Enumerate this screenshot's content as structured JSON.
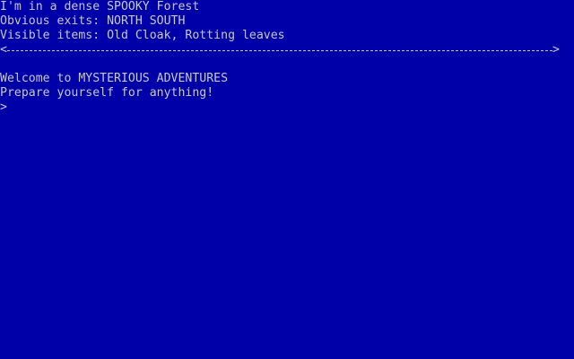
{
  "room": {
    "description": "I'm in a dense SPOOKY Forest",
    "exits": "Obvious exits: NORTH SOUTH",
    "items": "Visible items: Old Cloak, Rotting leaves"
  },
  "separator": {
    "left": "<",
    "right": ">"
  },
  "messages": [
    "Welcome to MYSTERIOUS ADVENTURES",
    "Prepare yourself for anything!"
  ],
  "prompt": ">",
  "colors": {
    "background": "#0000a8",
    "text": "#c8c8c8"
  }
}
